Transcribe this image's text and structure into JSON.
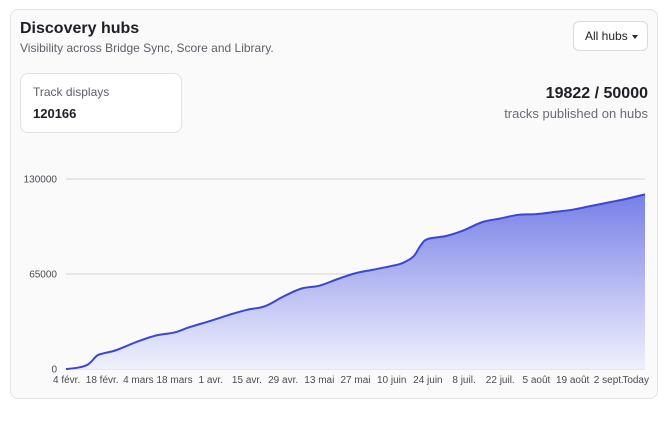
{
  "header": {
    "title": "Discovery hubs",
    "subtitle": "Visibility across Bridge Sync, Score and Library."
  },
  "filter": {
    "selected": "All hubs",
    "icon": "chevron-down-icon"
  },
  "stat_card": {
    "label": "Track displays",
    "value": "120166"
  },
  "progress": {
    "value_text": "19822 / 50000",
    "published": 19822,
    "target": 50000,
    "caption": "tracks published on hubs"
  },
  "colors": {
    "line": "#3b46d4",
    "fill_top": "#6f78e6",
    "fill_bottom": "#eef0fc",
    "grid": "#d4d4d8"
  },
  "chart_data": {
    "type": "area",
    "title": "",
    "xlabel": "",
    "ylabel": "",
    "ylim": [
      0,
      130000
    ],
    "y_ticks": [
      "0",
      "65000",
      "130000"
    ],
    "x_ticks": [
      "4 févr.",
      "18 févr.",
      "4 mars",
      "18 mars",
      "1 avr.",
      "15 avr.",
      "29 avr.",
      "13 mai",
      "27 mai",
      "10 juin",
      "24 juin",
      "8 juil.",
      "22 juil.",
      "5 août",
      "19 août",
      "2 sept.",
      "Today"
    ],
    "grid": true,
    "series": [
      {
        "values": [
          [
            0,
            0
          ],
          [
            0.3,
            800
          ],
          [
            0.6,
            3000
          ],
          [
            0.85,
            9000
          ],
          [
            1,
            10500
          ],
          [
            1.4,
            13000
          ],
          [
            2,
            19000
          ],
          [
            2.5,
            23000
          ],
          [
            3,
            25000
          ],
          [
            3.4,
            28500
          ],
          [
            4,
            33000
          ],
          [
            4.5,
            37000
          ],
          [
            5,
            40500
          ],
          [
            5.5,
            43000
          ],
          [
            6,
            49500
          ],
          [
            6.5,
            55000
          ],
          [
            7,
            57000
          ],
          [
            7.5,
            61500
          ],
          [
            8,
            65500
          ],
          [
            8.5,
            68000
          ],
          [
            9,
            70500
          ],
          [
            9.3,
            72500
          ],
          [
            9.6,
            77000
          ],
          [
            9.8,
            84500
          ],
          [
            10,
            89000
          ],
          [
            10.5,
            91000
          ],
          [
            11,
            95000
          ],
          [
            11.5,
            100500
          ],
          [
            12,
            103000
          ],
          [
            12.5,
            105500
          ],
          [
            13,
            106000
          ],
          [
            13.5,
            107500
          ],
          [
            14,
            109000
          ],
          [
            14.5,
            111500
          ],
          [
            15,
            114000
          ],
          [
            15.5,
            116500
          ],
          [
            16,
            119500
          ]
        ]
      }
    ]
  }
}
